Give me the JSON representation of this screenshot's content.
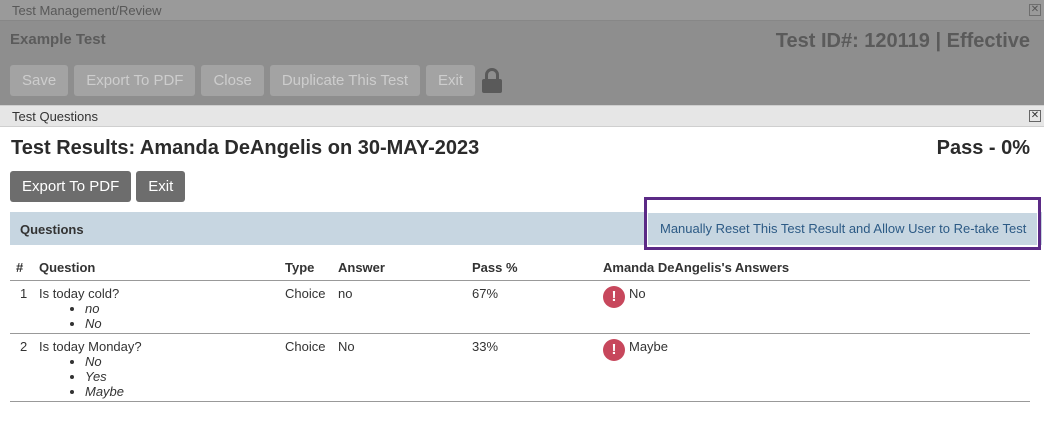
{
  "background_window": {
    "title": "Test Management/Review",
    "test_name": "Example Test",
    "test_id_text": "Test ID#: 120119 | Effective",
    "toolbar": [
      "Save",
      "Export To PDF",
      "Close",
      "Duplicate This Test",
      "Exit"
    ],
    "close_glyph": "✕"
  },
  "dialog": {
    "title": "Test Questions",
    "close_glyph": "✕",
    "result_title": "Test Results: Amanda DeAngelis on 30-MAY-2023",
    "result_status": "Pass - 0%",
    "buttons": {
      "export": "Export To PDF",
      "exit": "Exit"
    },
    "section_label": "Questions",
    "reset_link": "Manually Reset This Test Result and Allow User to Re-take Test",
    "error_glyph": "!",
    "table": {
      "headers": [
        "#",
        "Question",
        "Type",
        "Answer",
        "Pass %",
        "Amanda DeAngelis's Answers"
      ],
      "rows": [
        {
          "num": "1",
          "question": "Is today cold?",
          "options": [
            "no",
            "No"
          ],
          "type": "Choice",
          "answer": "no",
          "pass": "67%",
          "user_answer": "No"
        },
        {
          "num": "2",
          "question": "Is today Monday?",
          "options": [
            "No",
            "Yes",
            "Maybe"
          ],
          "type": "Choice",
          "answer": "No",
          "pass": "33%",
          "user_answer": "Maybe"
        }
      ]
    }
  },
  "colors": {
    "overlay_gray": "#8e8e8e",
    "highlight_border": "#5b2a86",
    "section_bar": "#c7d6e1",
    "error_icon": "#c7475c",
    "link": "#2c5a85"
  }
}
